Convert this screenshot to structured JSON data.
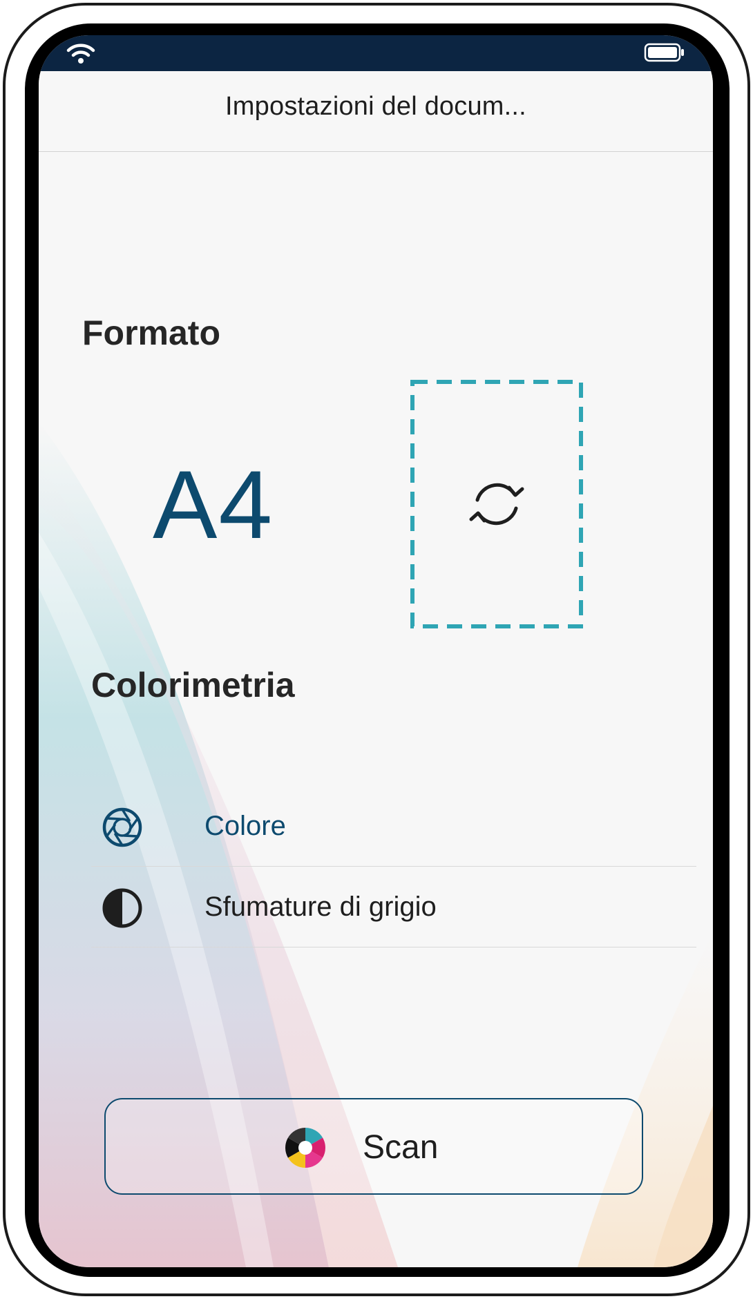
{
  "status_bar": {
    "wifi_icon": "wifi-icon",
    "battery_icon": "battery-icon",
    "background_color": "#0c2542"
  },
  "nav": {
    "title": "Impostazioni del docum..."
  },
  "format_section": {
    "title": "Formato",
    "value": "A4",
    "orientation_icon": "rotate-icon",
    "accent_color": "#2fa5b4"
  },
  "color_section": {
    "title": "Colorimetria",
    "options": [
      {
        "label": "Colore",
        "icon": "aperture-icon",
        "selected": true
      },
      {
        "label": "Sfumature di grigio",
        "icon": "contrast-icon",
        "selected": false
      }
    ],
    "selected_color": "#0d4a6e"
  },
  "scan_button": {
    "label": "Scan",
    "icon": "scan-logo-icon"
  }
}
